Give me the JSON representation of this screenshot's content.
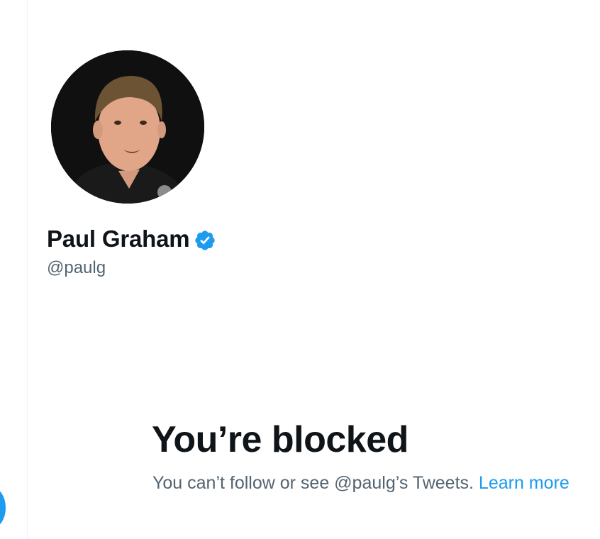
{
  "profile": {
    "display_name": "Paul Graham",
    "handle": "@paulg",
    "verified": true,
    "verified_icon": "verified-badge-icon"
  },
  "blocked": {
    "title": "You’re blocked",
    "message": "You can’t follow or see @paulg’s Tweets.",
    "link_label": "Learn more"
  },
  "colors": {
    "accent": "#1d9bf0",
    "text_primary": "#0f1419",
    "text_secondary": "#536471"
  }
}
